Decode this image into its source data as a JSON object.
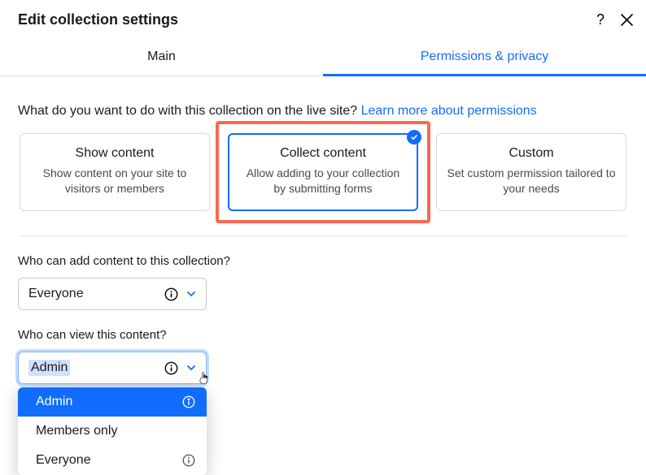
{
  "header": {
    "title": "Edit collection settings"
  },
  "tabs": {
    "main": "Main",
    "permissions": "Permissions & privacy"
  },
  "prompt": {
    "text": "What do you want to do with this collection on the live site? ",
    "link": "Learn more about permissions"
  },
  "cards": {
    "show": {
      "title": "Show content",
      "sub": "Show content on your site to visitors or members"
    },
    "collect": {
      "title": "Collect content",
      "sub": "Allow adding to your collection by submitting forms"
    },
    "custom": {
      "title": "Custom",
      "sub": "Set custom permission tailored to your needs"
    }
  },
  "fields": {
    "add": {
      "label": "Who can add content to this collection?",
      "value": "Everyone"
    },
    "view": {
      "label": "Who can view this content?",
      "value": "Admin"
    }
  },
  "dropdown": {
    "opt1": "Admin",
    "opt2": "Members only",
    "opt3": "Everyone"
  }
}
